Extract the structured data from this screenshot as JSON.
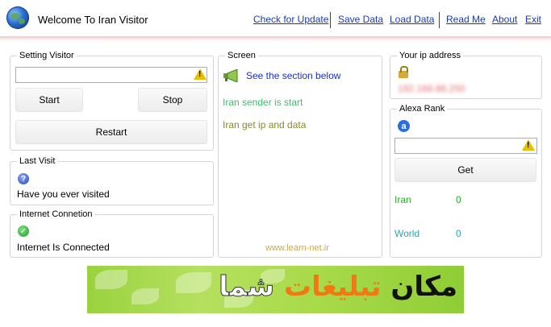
{
  "header": {
    "title": "Welcome To Iran Visitor",
    "menu": {
      "check_update": "Check for Update",
      "save_data": "Save Data",
      "load_data": "Load Data",
      "read_me": "Read Me",
      "about": "About",
      "exit": "Exit"
    }
  },
  "setting_visitor": {
    "label": "Setting Visitor",
    "input_value": "",
    "start": "Start",
    "stop": "Stop",
    "restart": "Restart"
  },
  "last_visit": {
    "label": "Last Visit",
    "text": "Have you ever visited"
  },
  "internet": {
    "label": "Internet Connetion",
    "text": "Internet Is Connected"
  },
  "screen": {
    "label": "Screen",
    "header_text": "See the section below",
    "line1": "Iran sender is start",
    "line2": "Iran get ip and data",
    "footer": "www.learn-net.ir"
  },
  "ip": {
    "label": "Your ip address",
    "value": "192.168.88.250"
  },
  "alexa": {
    "label": "Alexa Rank",
    "input_value": "",
    "get": "Get",
    "iran_label": "Iran",
    "iran_value": "0",
    "world_label": "World",
    "world_value": "0"
  },
  "banner": {
    "text_part1": "مکان",
    "text_part2": "تبلیغات",
    "text_part3": "شما"
  },
  "colors": {
    "link": "#1a3bb0",
    "screen_green": "#3dbf6a",
    "screen_olive": "#8a8a2a",
    "alexa_green": "#1db31d",
    "world_teal": "#2aa7b0"
  }
}
